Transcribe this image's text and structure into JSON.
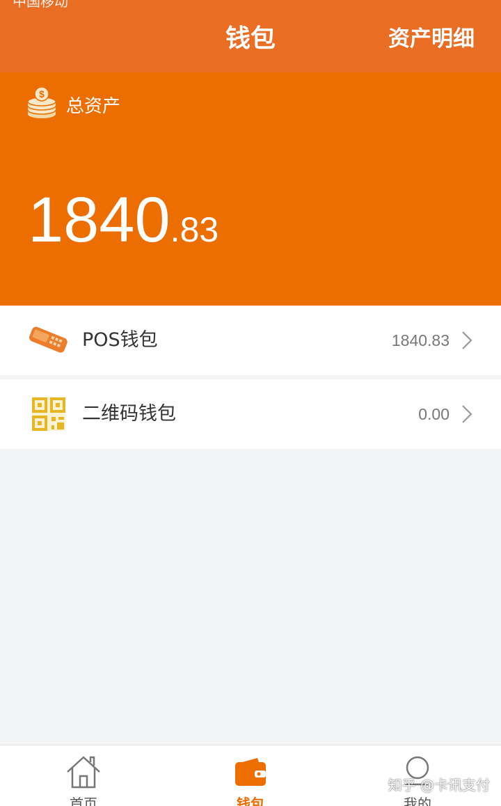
{
  "status_bar": {
    "remnant_text": "中国移动"
  },
  "header": {
    "title": "钱包",
    "action_label": "资产明细",
    "background": "#ea6d24"
  },
  "hero": {
    "icon": "coins-icon",
    "label": "总资产",
    "balance_integer": "1840",
    "balance_decimal": ".83",
    "background": "#ec6d00"
  },
  "wallets": [
    {
      "icon": "pos-terminal-icon",
      "label": "POS钱包",
      "amount": "1840.83"
    },
    {
      "icon": "qr-code-icon",
      "label": "二维码钱包",
      "amount": "0.00"
    }
  ],
  "bottom_nav": {
    "items": [
      {
        "icon": "home-icon",
        "label": "首页",
        "active": false
      },
      {
        "icon": "wallet-icon",
        "label": "钱包",
        "active": true
      },
      {
        "icon": "search-icon",
        "label": "我的",
        "active": false
      }
    ],
    "active_color": "#ec6d00"
  },
  "watermark": "知乎 @卡讯支付"
}
